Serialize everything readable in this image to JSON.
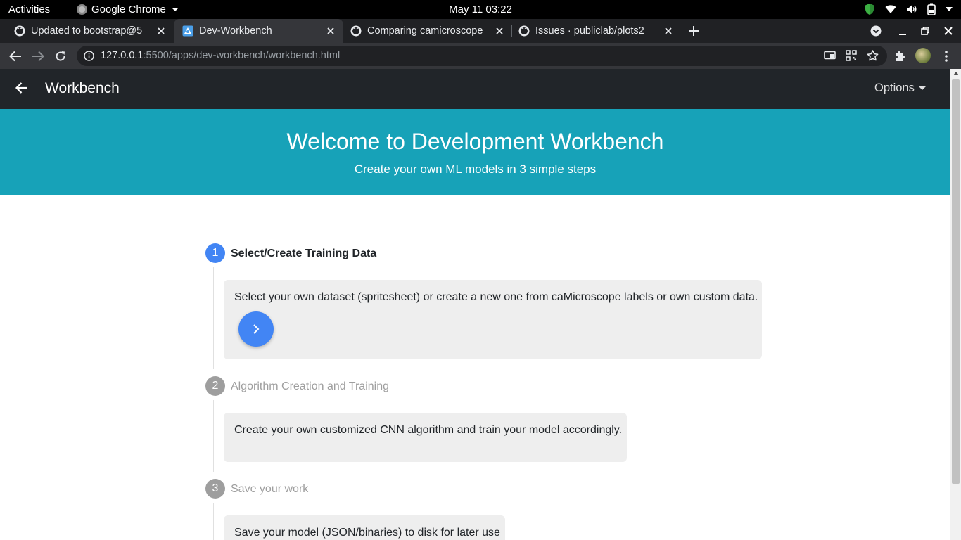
{
  "os_bar": {
    "activities": "Activities",
    "app_name": "Google Chrome",
    "clock": "May 11  03:22"
  },
  "tabs": [
    {
      "title": "Updated to bootstrap@5",
      "icon": "github-icon",
      "active": false
    },
    {
      "title": "Dev-Workbench",
      "icon": "workbench-favicon",
      "active": true
    },
    {
      "title": "Comparing camicroscope",
      "icon": "github-icon",
      "active": false
    },
    {
      "title": "Issues · publiclab/plots2",
      "icon": "github-icon",
      "active": false
    }
  ],
  "omnibox": {
    "host": "127.0.0.1",
    "rest": ":5500/apps/dev-workbench/workbench.html"
  },
  "navbar": {
    "brand": "Workbench",
    "options": "Options"
  },
  "hero": {
    "title_light": "Welcome to ",
    "title_bold": "Development Workbench",
    "subtitle": "Create your own ML models in 3 simple steps"
  },
  "steps": [
    {
      "number": "1",
      "title": "Select/Create Training Data",
      "description": "Select your own dataset (spritesheet) or create a new one from caMicroscope labels or own custom data.",
      "active": true
    },
    {
      "number": "2",
      "title": "Algorithm Creation and Training",
      "description": "Create your own customized CNN algorithm and train your model accordingly.",
      "active": false
    },
    {
      "number": "3",
      "title": "Save your work",
      "description": "Save your model (JSON/binaries) to disk for later use",
      "active": false
    }
  ],
  "colors": {
    "hero_bg": "#17a2b8",
    "navbar_bg": "#212529",
    "step_active": "#4285f4",
    "step_inactive": "#9e9e9e"
  }
}
